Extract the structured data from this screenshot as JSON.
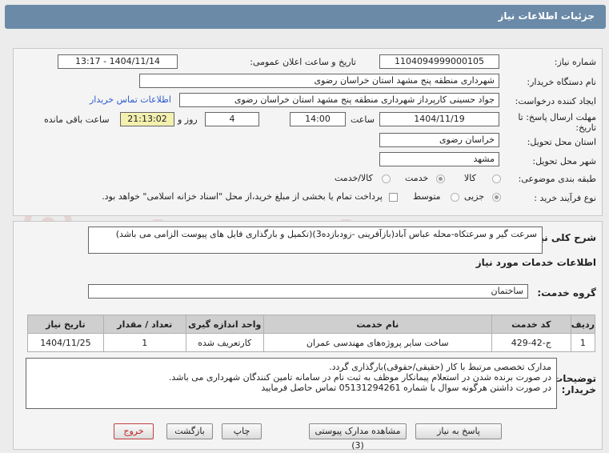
{
  "page_title": "جزئیات اطلاعات نیاز",
  "need_number": {
    "label": "شماره نیاز:",
    "value": "1104094999000105"
  },
  "announce_date": {
    "label": "تاریخ و ساعت اعلان عمومی:",
    "value": "1404/11/14 - 13:17"
  },
  "buyer_org": {
    "label": "نام دستگاه خریدار:",
    "value": "شهرداری منطقه پنج مشهد استان خراسان رضوی"
  },
  "requester": {
    "label": "ایجاد کننده درخواست:",
    "value": "جواد حسینی کارپرداز شهرداری منطقه پنج مشهد استان خراسان رضوی",
    "contact_link": "اطلاعات تماس خریدار"
  },
  "deadline": {
    "label_line1": "مهلت ارسال پاسخ: تا",
    "label_line2": "تاریخ:",
    "date": "1404/11/19",
    "time_label": "ساعت",
    "time": "14:00",
    "days": "4",
    "days_label": "روز و",
    "remaining_time": "21:13:02",
    "remaining_label": "ساعت باقی مانده"
  },
  "province": {
    "label": "استان محل تحویل:",
    "value": "خراسان رضوی"
  },
  "city": {
    "label": "شهر محل تحویل:",
    "value": "مشهد"
  },
  "category": {
    "label": "طبقه بندی موضوعی:",
    "options": [
      "کالا",
      "خدمت",
      "کالا/خدمت"
    ],
    "selected": "خدمت"
  },
  "purchase_type": {
    "label": "نوع فرآیند خرید :",
    "options": [
      "جزیی",
      "متوسط"
    ],
    "selected": "جزیی",
    "checkbox_label": "پرداخت تمام یا بخشی از مبلغ خرید،از محل \"اسناد خزانه اسلامی\" خواهد بود."
  },
  "description": {
    "label": "شرح کلی نیاز:",
    "value": "سرعت گیر و سرعتکاه-محله عباس آباد(بازآفرینی -زودبازده3)(تکمیل و بارگذاری فایل های پیوست الزامی می باشد)"
  },
  "services_heading": "اطلاعات خدمات مورد نیاز",
  "service_group": {
    "label": "گروه خدمت:",
    "value": "ساختمان"
  },
  "table": {
    "headers": [
      "ردیف",
      "کد خدمت",
      "نام خدمت",
      "واحد اندازه گیری",
      "تعداد / مقدار",
      "تاریخ نیاز"
    ],
    "rows": [
      [
        "1",
        "ج-42-429",
        "ساخت سایر پروژه‌های مهندسی عمران",
        "کارتعریف شده",
        "1",
        "1404/11/25"
      ]
    ]
  },
  "buyer_notes": {
    "label_line1": "توضیحات",
    "label_line2": "خریدار:",
    "lines": [
      "مدارک تخصصی مرتبط با کار (حقیقی/حقوقی)بارگذاری گردد.",
      "در صورت برنده شدن در استعلام پیمانکار موظف به ثبت نام در سامانه تامین کنندگان شهرداری می باشد.",
      "در صورت داشتن هرگونه سوال  با شماره 05131294261 تماس حاصل فرمایید"
    ]
  },
  "buttons": {
    "reply": "پاسخ به نیاز",
    "docs": "مشاهده مدارک پیوستی (3)",
    "print": "چاپ",
    "back": "بازگشت",
    "exit": "خروج"
  },
  "watermark": "AriaTender.net",
  "colors": {
    "title_bar": "#6a8aa8",
    "link": "#2a5ad0",
    "timer_bg": "#f3f0b0",
    "exit_text": "#c02020"
  }
}
